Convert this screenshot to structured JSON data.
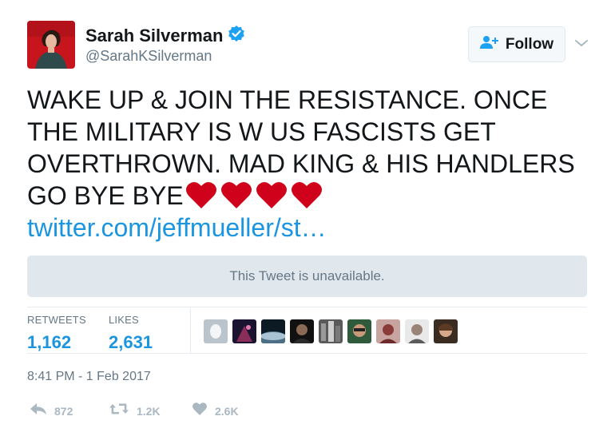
{
  "user": {
    "name": "Sarah Silverman",
    "handle": "@SarahKSilverman",
    "verified": true
  },
  "follow_button": {
    "label": "Follow"
  },
  "tweet": {
    "lines": [
      "WAKE UP & JOIN THE RESISTANCE.  ONCE",
      "THE MILITARY IS W US FASCISTS GET",
      "OVERTHROWN. MAD KING & HIS HANDLERS",
      "GO BYE BYE"
    ],
    "emoji": [
      "red-heart",
      "red-heart",
      "red-heart",
      "red-heart"
    ],
    "link": "twitter.com/jeffmueller/st…"
  },
  "quoted_tweet": {
    "text": "This Tweet is unavailable."
  },
  "stats": {
    "retweets_label": "RETWEETS",
    "retweets_value": "1,162",
    "likes_label": "LIKES",
    "likes_value": "2,631"
  },
  "timestamp": "8:41 PM - 1 Feb 2017",
  "actions": {
    "reply_count": "872",
    "retweet_count": "1.2K",
    "like_count": "2.6K"
  },
  "colors": {
    "link": "#1b95e0",
    "secondary_text": "#657786",
    "heart": "#d0021b",
    "action_gray": "#aab8c2"
  }
}
